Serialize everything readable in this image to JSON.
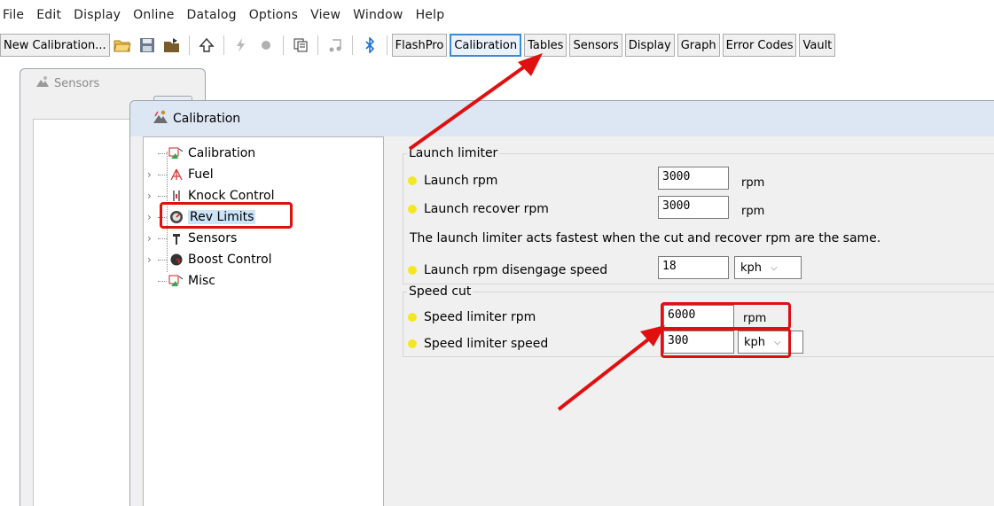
{
  "menubar": {
    "items": [
      "File",
      "Edit",
      "Display",
      "Online",
      "Datalog",
      "Options",
      "View",
      "Window",
      "Help"
    ]
  },
  "toolbar": {
    "new_calibration_label": "New Calibration...",
    "tabs": [
      "FlashPro",
      "Calibration",
      "Tables",
      "Sensors",
      "Display",
      "Graph",
      "Error Codes",
      "Vault"
    ],
    "active_tab": "Calibration"
  },
  "sensors_window": {
    "title": "Sensors",
    "close_label": "✕"
  },
  "calibration_window": {
    "title": "Calibration",
    "tree": {
      "items": [
        {
          "label": "Calibration",
          "icon": "calibration-icon",
          "expandable": false
        },
        {
          "label": "Fuel",
          "icon": "fuel-icon",
          "expandable": true
        },
        {
          "label": "Knock Control",
          "icon": "knock-icon",
          "expandable": true
        },
        {
          "label": "Rev Limits",
          "icon": "rev-limits-icon",
          "expandable": true,
          "selected": true
        },
        {
          "label": "Sensors",
          "icon": "sensors-icon",
          "expandable": true
        },
        {
          "label": "Boost Control",
          "icon": "boost-icon",
          "expandable": true
        },
        {
          "label": "Misc",
          "icon": "misc-icon",
          "expandable": false
        }
      ]
    },
    "launch_limiter": {
      "title": "Launch limiter",
      "launch_rpm": {
        "label": "Launch rpm",
        "value": "3000",
        "unit": "rpm"
      },
      "launch_recover_rpm": {
        "label": "Launch recover rpm",
        "value": "3000",
        "unit": "rpm"
      },
      "note": "The launch limiter acts fastest when the cut and recover rpm are the same.",
      "disengage_speed": {
        "label": "Launch rpm disengage speed",
        "value": "18",
        "unit": "kph"
      }
    },
    "speed_cut": {
      "title": "Speed cut",
      "speed_limiter_rpm": {
        "label": "Speed limiter rpm",
        "value": "6000",
        "unit": "rpm"
      },
      "speed_limiter_speed": {
        "label": "Speed limiter speed",
        "value": "300",
        "unit": "kph"
      }
    }
  },
  "colors": {
    "highlight": "#e01010",
    "bullet": "#f5e623",
    "titlebar": "#dce7f3",
    "active_tab_border": "#3c8ad6"
  }
}
